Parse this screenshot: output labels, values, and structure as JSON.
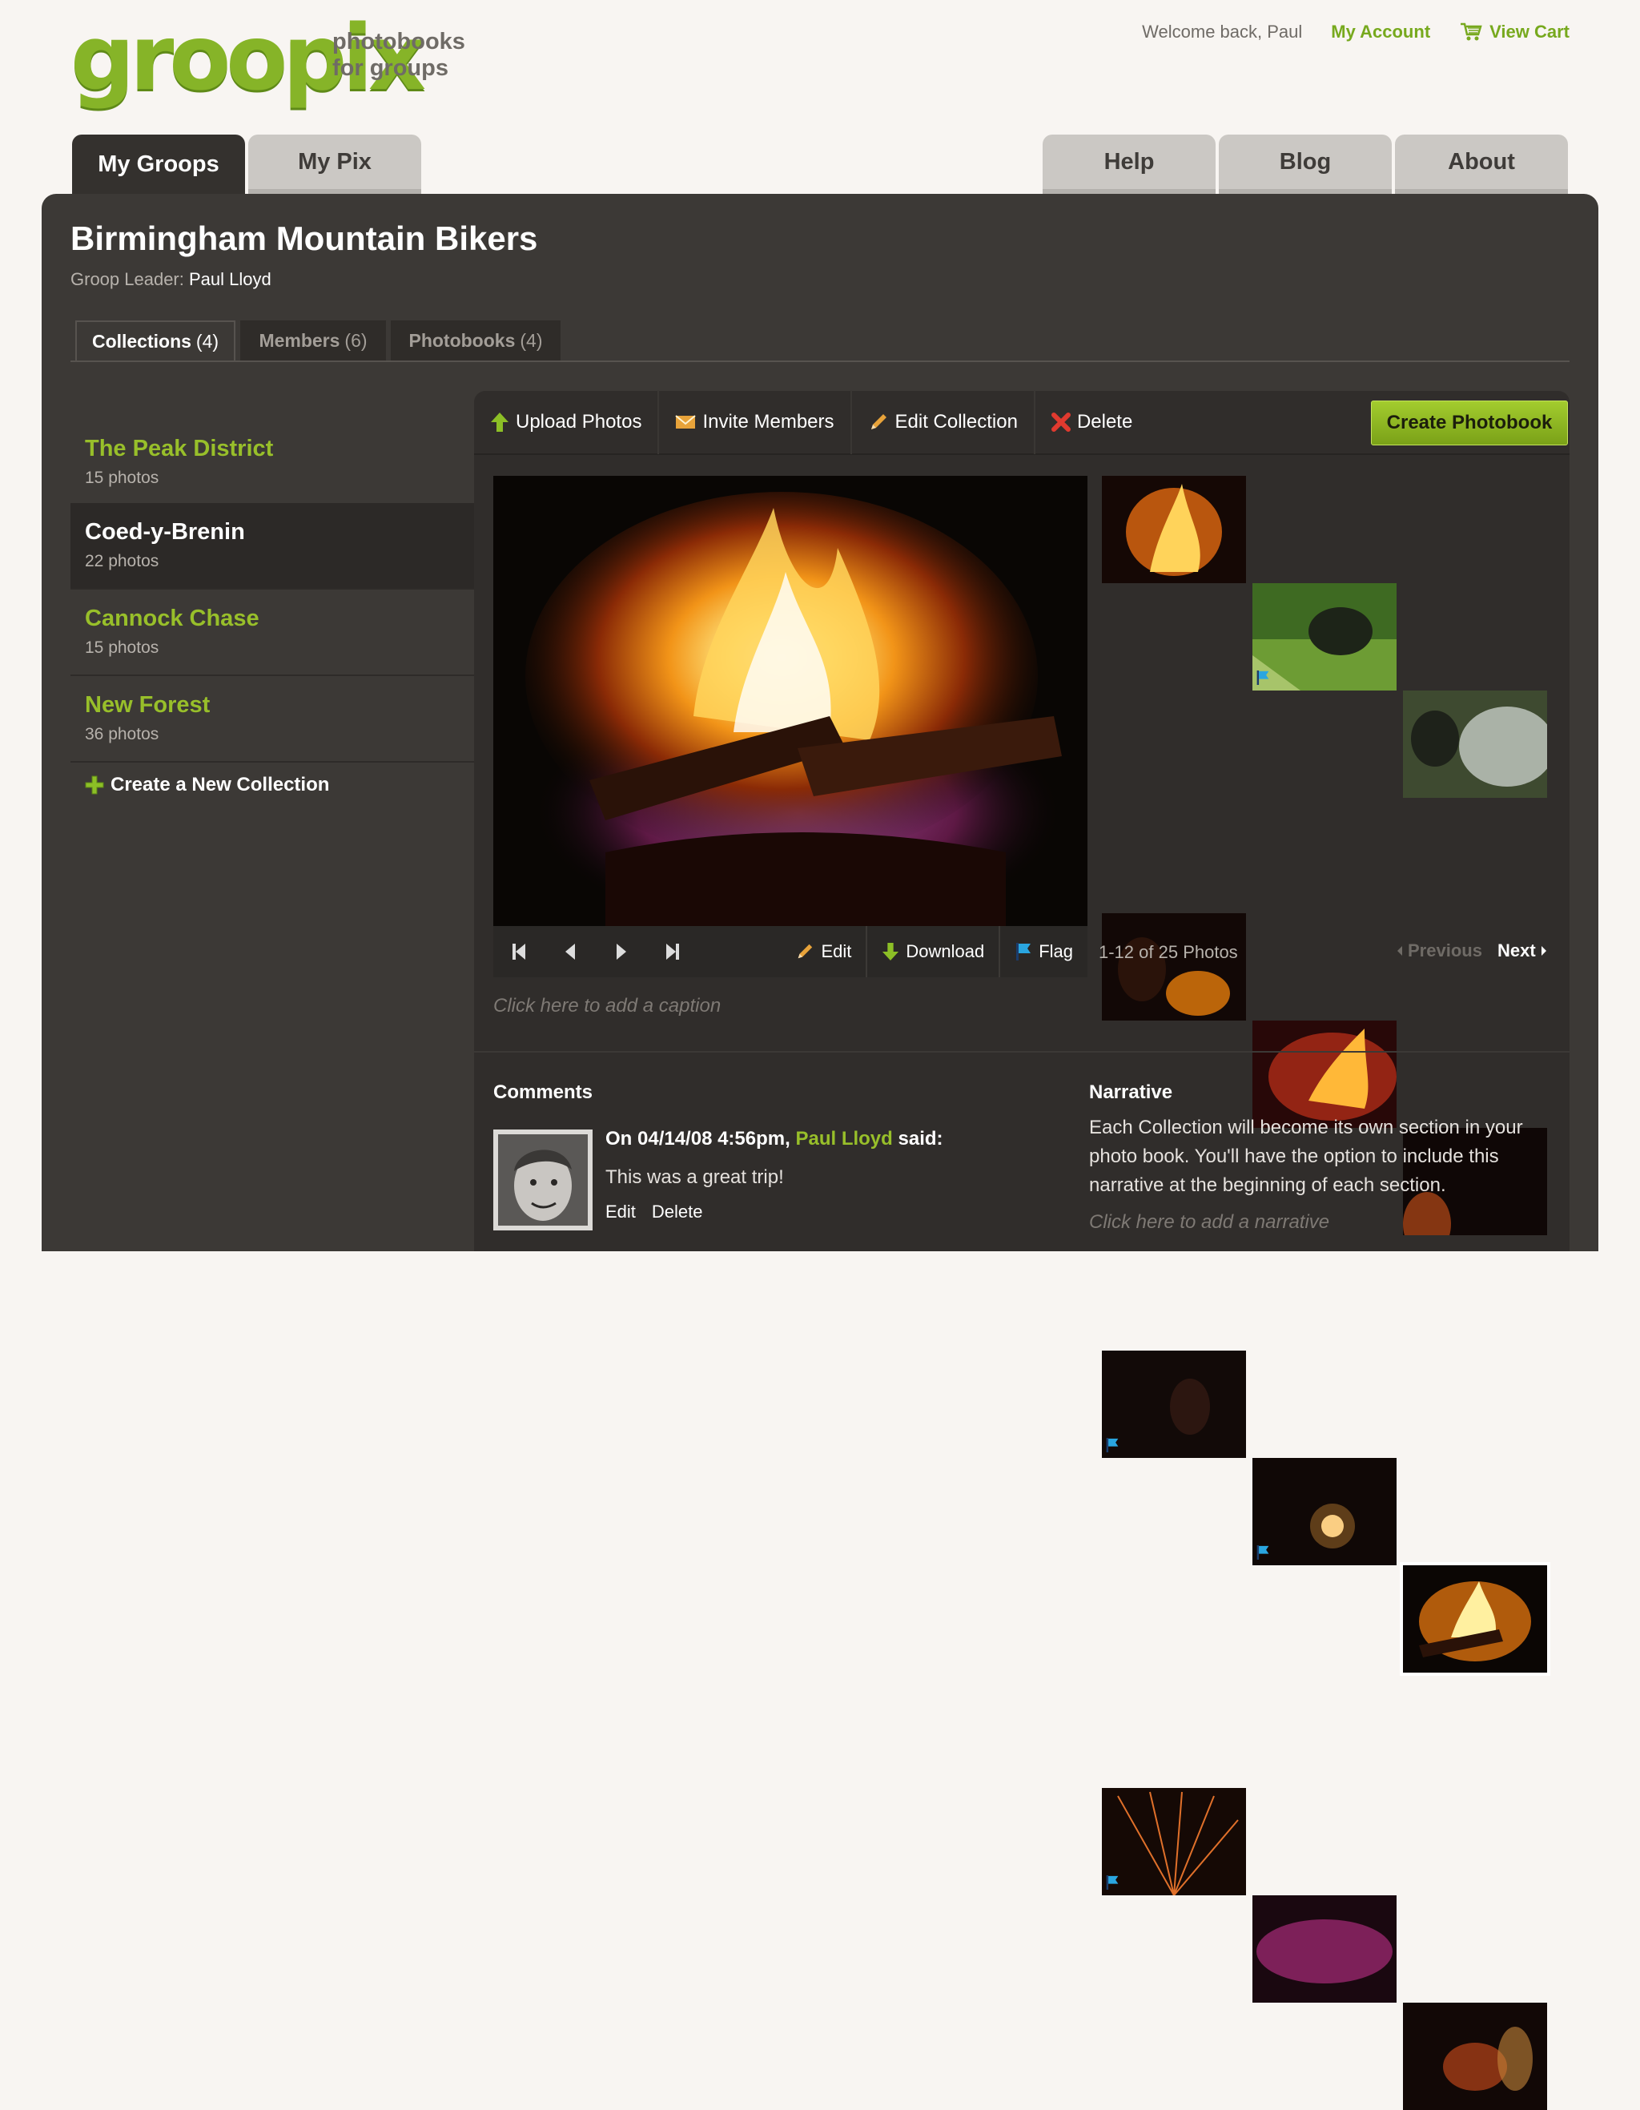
{
  "brand": {
    "logo": "groopix",
    "tagline_line1": "photobooks",
    "tagline_line2": "for groups",
    "accent_color": "#86b428"
  },
  "header": {
    "welcome": "Welcome back, Paul",
    "my_account": "My Account",
    "view_cart": "View Cart"
  },
  "main_tabs": {
    "my_groops": "My Groops",
    "my_pix": "My Pix",
    "help": "Help",
    "blog": "Blog",
    "about": "About"
  },
  "group": {
    "title": "Birmingham Mountain Bikers",
    "leader_label": "Groop Leader:",
    "leader_name": "Paul Lloyd"
  },
  "sub_tabs": [
    {
      "label": "Collections",
      "count": "(4)"
    },
    {
      "label": "Members",
      "count": "(6)"
    },
    {
      "label": "Photobooks",
      "count": "(4)"
    }
  ],
  "collections": [
    {
      "name": "The Peak District",
      "count": "15 photos"
    },
    {
      "name": "Coed-y-Brenin",
      "count": "22 photos"
    },
    {
      "name": "Cannock Chase",
      "count": "15 photos"
    },
    {
      "name": "New Forest",
      "count": "36 photos"
    }
  ],
  "create_collection": "Create a New Collection",
  "toolbar": {
    "upload": "Upload Photos",
    "invite": "Invite Members",
    "edit_collection": "Edit Collection",
    "delete": "Delete",
    "create_photobook": "Create Photobook"
  },
  "photo_controls": {
    "edit": "Edit",
    "download": "Download",
    "flag": "Flag"
  },
  "pager": {
    "info": "1-12 of 25 Photos",
    "previous": "Previous",
    "next": "Next"
  },
  "caption_placeholder": "Click here to add a caption",
  "comments": {
    "heading": "Comments",
    "items": [
      {
        "prefix": "On 04/14/08 4:56pm,",
        "author": "Paul Lloyd",
        "suffix": "said:",
        "text": "This was a great trip!",
        "edit": "Edit",
        "delete": "Delete"
      }
    ]
  },
  "narrative": {
    "heading": "Narrative",
    "text": "Each Collection will become its own section in your photo book. You'll have the option to include this narrative at the beginning of each section.",
    "placeholder": "Click here to add a narrative"
  }
}
